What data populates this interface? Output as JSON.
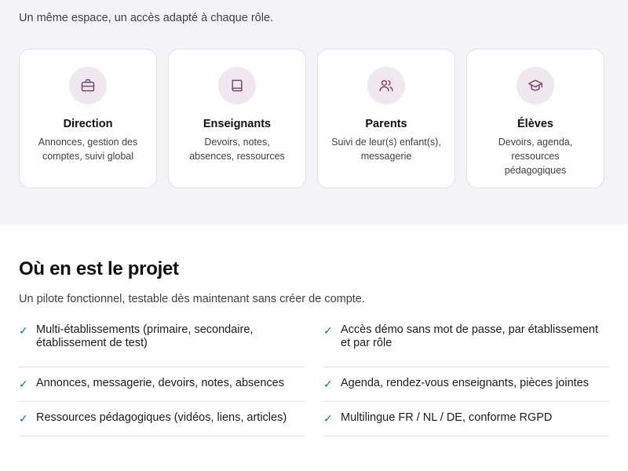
{
  "roles_section": {
    "subtitle": "Un même espace, un accès adapté à chaque rôle.",
    "roles": [
      {
        "icon": "briefcase-icon",
        "title": "Direction",
        "description": "Annonces, gestion des comptes, suivi global"
      },
      {
        "icon": "book-icon",
        "title": "Enseignants",
        "description": "Devoirs, notes, absences, ressources"
      },
      {
        "icon": "users-icon",
        "title": "Parents",
        "description": "Suivi de leur(s) enfant(s), messagerie"
      },
      {
        "icon": "graduation-cap-icon",
        "title": "Élèves",
        "description": "Devoirs, agenda, ressources pédagogiques"
      }
    ]
  },
  "project_section": {
    "title": "Où en est le projet",
    "subtitle": "Un pilote fonctionnel, testable dès maintenant sans créer de compte.",
    "check_glyph": "✓",
    "features": [
      "Multi-établissements (primaire, secondaire, établissement de test)",
      "Accès démo sans mot de passe, par établissement et par rôle",
      "Annonces, messagerie, devoirs, notes, absences",
      "Agenda, rendez-vous enseignants, pièces jointes",
      "Ressources pédagogiques (vidéos, liens, articles)",
      "Multilingue FR / NL / DE, conforme RGPD"
    ]
  },
  "colors": {
    "accent_icon": "#7a4a6e",
    "icon_background": "#f1e8ef",
    "check": "#0f7a66",
    "section_background": "#f4f4f6"
  }
}
